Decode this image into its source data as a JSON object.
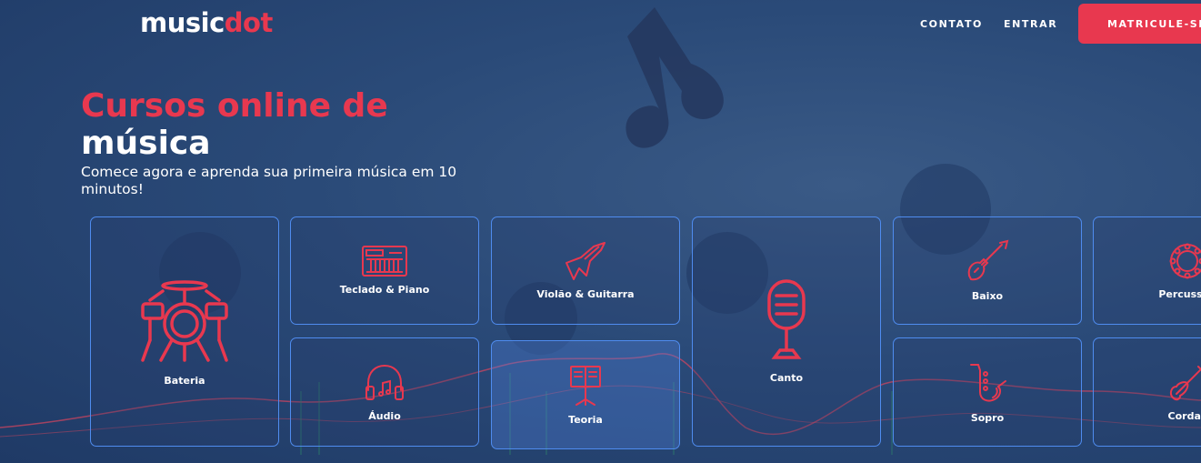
{
  "header": {
    "logo_main": "music",
    "logo_accent": "dot",
    "nav": {
      "contact": "CONTATO",
      "login": "ENTRAR"
    },
    "cta": "MATRICULE-SE"
  },
  "hero": {
    "title_line1": "Cursos online de",
    "title_line2": "música",
    "subtitle": "Comece agora e aprenda sua primeira música em 10 minutos!"
  },
  "courses": [
    {
      "label": "Bateria",
      "icon": "drums-icon"
    },
    {
      "label": "Teclado & Piano",
      "icon": "keyboard-icon"
    },
    {
      "label": "Violão & Guitarra",
      "icon": "guitar-icon"
    },
    {
      "label": "Canto",
      "icon": "microphone-icon"
    },
    {
      "label": "Baixo",
      "icon": "bass-icon"
    },
    {
      "label": "Percussão",
      "icon": "tambourine-icon"
    },
    {
      "label": "Áudio",
      "icon": "headphones-icon"
    },
    {
      "label": "Teoria",
      "icon": "music-stand-icon"
    },
    {
      "label": "Sopro",
      "icon": "saxophone-icon"
    },
    {
      "label": "Cordas",
      "icon": "violin-icon"
    }
  ],
  "colors": {
    "accent": "#e8384f",
    "background": "#2a4a78",
    "card_border": "#4f8cef"
  }
}
